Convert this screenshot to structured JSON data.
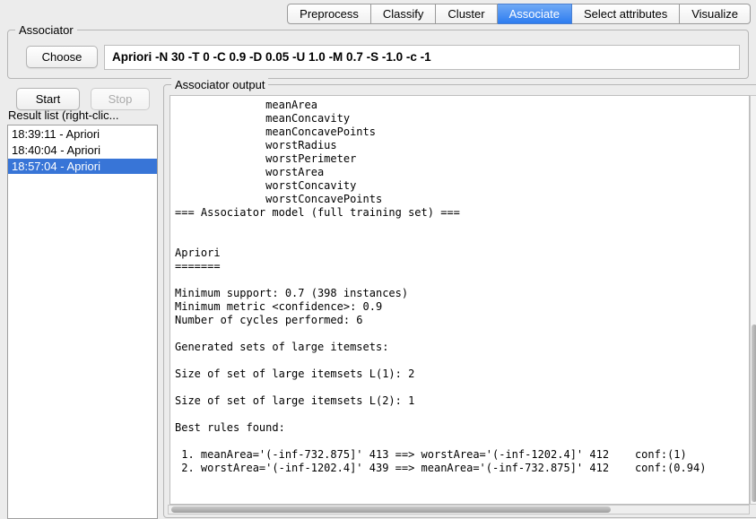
{
  "tabs": [
    {
      "label": "Preprocess"
    },
    {
      "label": "Classify"
    },
    {
      "label": "Cluster"
    },
    {
      "label": "Associate"
    },
    {
      "label": "Select attributes"
    },
    {
      "label": "Visualize"
    }
  ],
  "selected_tab": "Associate",
  "associator": {
    "group_title": "Associator",
    "choose_button": "Choose",
    "scheme": "Apriori -N 30 -T 0 -C 0.9 -D 0.05 -U 1.0 -M 0.7 -S -1.0 -c -1"
  },
  "controls": {
    "start": "Start",
    "stop": "Stop"
  },
  "result_list": {
    "title": "Result list (right-clic...",
    "selected_index": 2,
    "items": [
      {
        "label": "18:39:11 - Apriori"
      },
      {
        "label": "18:40:04 - Apriori"
      },
      {
        "label": "18:57:04 - Apriori"
      }
    ]
  },
  "output": {
    "group_title": "Associator output",
    "text": "              meanArea\n              meanConcavity\n              meanConcavePoints\n              worstRadius\n              worstPerimeter\n              worstArea\n              worstConcavity\n              worstConcavePoints\n=== Associator model (full training set) ===\n\n\nApriori\n=======\n\nMinimum support: 0.7 (398 instances)\nMinimum metric <confidence>: 0.9\nNumber of cycles performed: 6\n\nGenerated sets of large itemsets:\n\nSize of set of large itemsets L(1): 2\n\nSize of set of large itemsets L(2): 1\n\nBest rules found:\n\n 1. meanArea='(-inf-732.875]' 413 ==> worstArea='(-inf-1202.4]' 412    conf:(1)\n 2. worstArea='(-inf-1202.4]' 439 ==> meanArea='(-inf-732.875]' 412    conf:(0.94)"
  },
  "colors": {
    "accent": "#2d7cf0",
    "selection": "#3875d7",
    "background": "#ececec"
  }
}
